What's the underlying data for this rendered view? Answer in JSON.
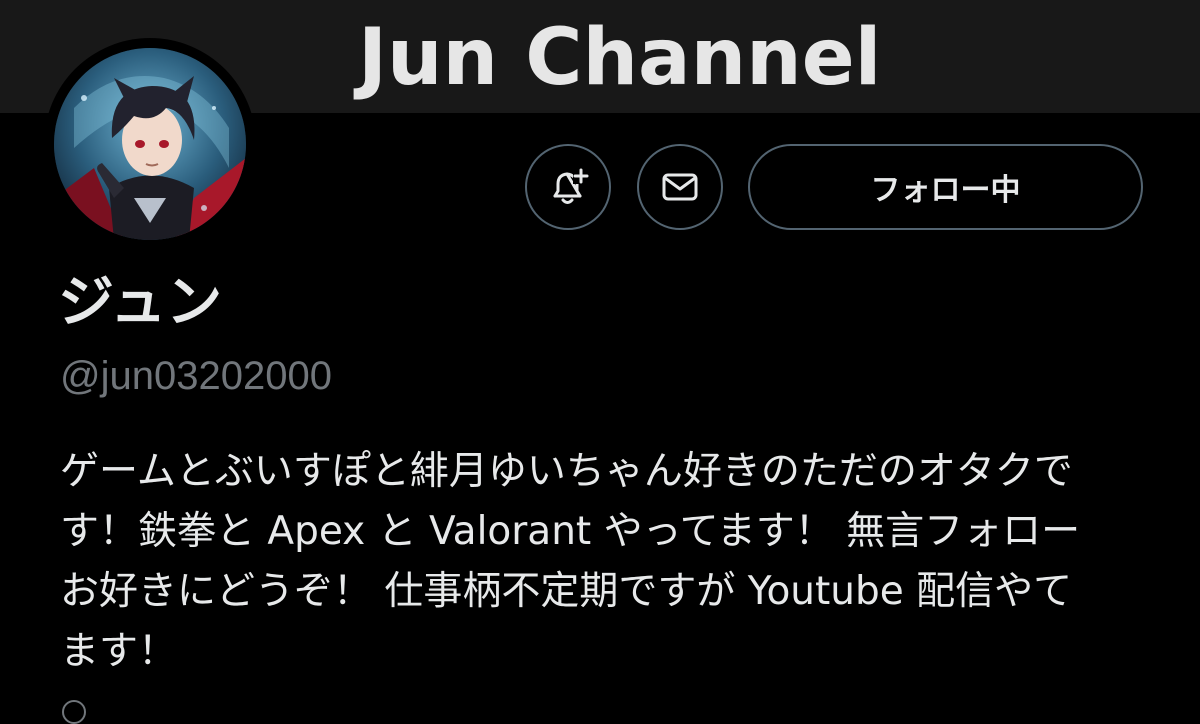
{
  "banner": {
    "title": "Jun Channel"
  },
  "profile": {
    "display_name": "ジュン",
    "handle": "@jun03202000",
    "bio_lines": [
      "ゲームとぶいすぽと緋月ゆいちゃん好きのただのオタクで",
      "す！鉄拳と Apex と Valorant やってます！ 無言フォロー",
      "お好きにどうぞ！ 仕事柄不定期ですが Youtube 配信やて",
      "ます！"
    ]
  },
  "actions": {
    "notify_icon": "bell-plus-icon",
    "message_icon": "envelope-icon",
    "follow_label": "フォロー中"
  },
  "colors": {
    "background": "#000000",
    "banner": "#181818",
    "text_primary": "#e7e9ea",
    "text_secondary": "#71767b",
    "border": "#536471"
  }
}
